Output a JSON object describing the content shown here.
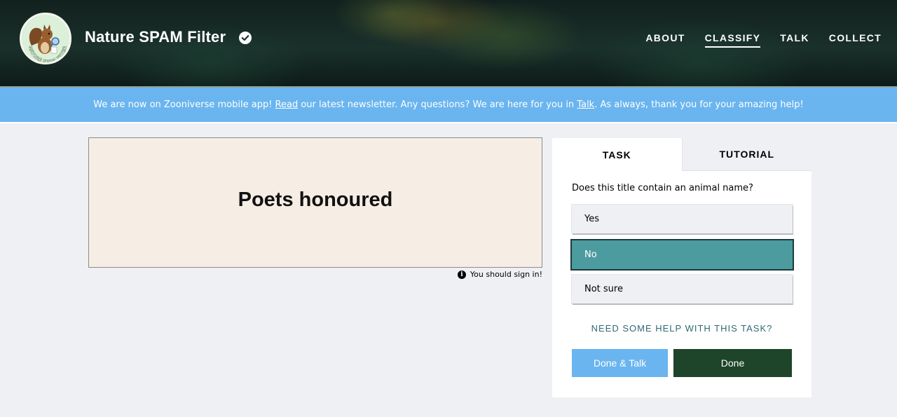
{
  "header": {
    "project_title": "Nature SPAM Filter",
    "logo_text": "NATURE SPAM FILTER",
    "nav": [
      {
        "label": "ABOUT",
        "active": false
      },
      {
        "label": "CLASSIFY",
        "active": true
      },
      {
        "label": "TALK",
        "active": false
      },
      {
        "label": "COLLECT",
        "active": false
      }
    ]
  },
  "banner": {
    "part1": "We are now on Zooniverse mobile app! ",
    "link1": "Read",
    "part2": " our latest newsletter. Any questions? We are here for you in ",
    "link2": "Talk",
    "part3": ". As always, thank you for your amazing help!"
  },
  "subject": {
    "text": "Poets honoured",
    "signin_notice": "You should sign in!"
  },
  "task_panel": {
    "tabs": [
      {
        "label": "TASK",
        "active": true
      },
      {
        "label": "TUTORIAL",
        "active": false
      }
    ],
    "question": "Does this title contain an animal name?",
    "answers": [
      {
        "label": "Yes",
        "selected": false
      },
      {
        "label": "No",
        "selected": true
      },
      {
        "label": "Not sure",
        "selected": false
      }
    ],
    "help_link": "NEED SOME HELP WITH THIS TASK?",
    "done_talk_label": "Done & Talk",
    "done_label": "Done"
  },
  "colors": {
    "banner": "#6ab5ef",
    "selected_answer": "#4b9b9f",
    "done_button": "#1e4429",
    "done_talk_button": "#6ab5ef",
    "help_link": "#2f6a74"
  }
}
